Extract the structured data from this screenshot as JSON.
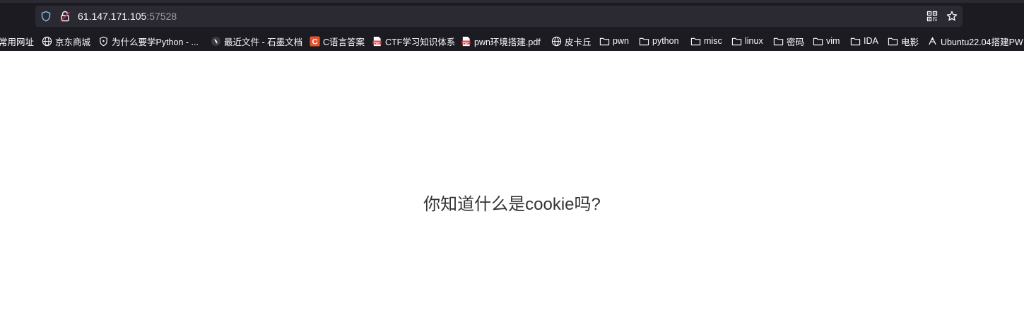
{
  "browser": {
    "url_host": "61.147.171.105",
    "url_port": ":57528",
    "bookmarks": [
      {
        "label": "常用网址",
        "icon": "none"
      },
      {
        "label": "京东商城",
        "icon": "globe-icon"
      },
      {
        "label": "为什么要学Python - ...",
        "icon": "shield-icon"
      },
      {
        "label": "最近文件 - 石墨文档",
        "icon": "shimo-icon"
      },
      {
        "label": "C语言答案",
        "icon": "c-logo-icon"
      },
      {
        "label": "CTF学习知识体系",
        "icon": "pdf-icon"
      },
      {
        "label": "pwn环境搭建.pdf",
        "icon": "pdf-icon"
      },
      {
        "label": "皮卡丘",
        "icon": "globe-icon"
      },
      {
        "label": "pwn",
        "icon": "folder-icon"
      },
      {
        "label": "python",
        "icon": "folder-icon"
      },
      {
        "label": "misc",
        "icon": "folder-icon"
      },
      {
        "label": "linux",
        "icon": "folder-icon"
      },
      {
        "label": "密码",
        "icon": "folder-icon"
      },
      {
        "label": "vim",
        "icon": "folder-icon"
      },
      {
        "label": "IDA",
        "icon": "folder-icon"
      },
      {
        "label": "电影",
        "icon": "folder-icon"
      },
      {
        "label": "Ubuntu22.04搭建PW",
        "icon": "ubuntu-icon"
      }
    ]
  },
  "page": {
    "question": "你知道什么是cookie吗?"
  },
  "colors": {
    "toolbar_bg": "#1c1b22",
    "urlbar_bg": "#2b2a33",
    "shield_blue": "#7ec3f0",
    "insecure_red": "#e22850",
    "c_logo_red": "#e8542c",
    "pdf_red": "#d93a3a"
  }
}
